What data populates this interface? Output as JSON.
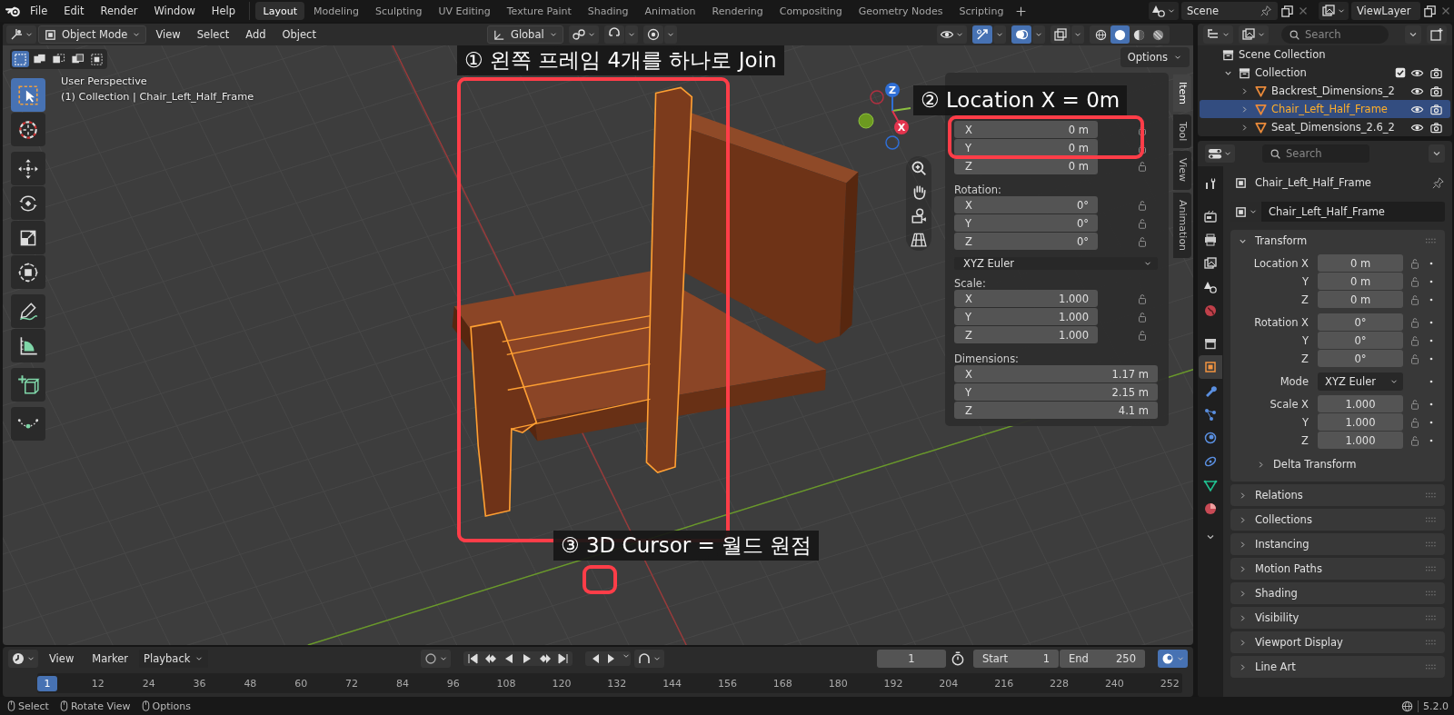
{
  "menu": [
    "File",
    "Edit",
    "Render",
    "Window",
    "Help"
  ],
  "workspace_tabs": [
    {
      "label": "Layout",
      "selected": true
    },
    {
      "label": "Modeling",
      "selected": false
    },
    {
      "label": "Sculpting",
      "selected": false
    },
    {
      "label": "UV Editing",
      "selected": false
    },
    {
      "label": "Texture Paint",
      "selected": false
    },
    {
      "label": "Shading",
      "selected": false
    },
    {
      "label": "Animation",
      "selected": false
    },
    {
      "label": "Rendering",
      "selected": false
    },
    {
      "label": "Compositing",
      "selected": false
    },
    {
      "label": "Geometry Nodes",
      "selected": false
    },
    {
      "label": "Scripting",
      "selected": false
    }
  ],
  "scene": {
    "name": "Scene"
  },
  "view_layer": {
    "name": "ViewLayer"
  },
  "viewport": {
    "header": {
      "mode": "Object Mode",
      "menus": [
        "View",
        "Select",
        "Add",
        "Object"
      ],
      "orientation": "Global",
      "toggles": [
        {
          "kind": "snap",
          "on": false
        },
        {
          "kind": "proportional",
          "on": false
        },
        {
          "kind": "gizmo",
          "on": true
        },
        {
          "kind": "overlay",
          "on": true
        },
        {
          "kind": "xray",
          "on": false
        }
      ],
      "shading_modes": [
        {
          "kind": "wireframe",
          "selected": false
        },
        {
          "kind": "solid",
          "selected": true
        },
        {
          "kind": "material",
          "selected": false
        },
        {
          "kind": "rendered",
          "selected": false
        }
      ]
    },
    "select_modes": [
      {
        "kind": "set",
        "selected": true
      },
      {
        "kind": "extend",
        "selected": false
      },
      {
        "kind": "subtract",
        "selected": false
      },
      {
        "kind": "invert",
        "selected": false
      },
      {
        "kind": "intersect",
        "selected": false
      }
    ],
    "options": "Options",
    "view_info": [
      "User Perspective",
      "(1) Collection | Chair_Left_Half_Frame"
    ],
    "tool_groups": [
      {
        "tools": [
          {
            "kind": "select_box",
            "selected": true
          },
          {
            "kind": "cursor",
            "selected": false
          }
        ]
      },
      {
        "tools": [
          {
            "kind": "move",
            "selected": false
          },
          {
            "kind": "rotate",
            "selected": false
          },
          {
            "kind": "scale",
            "selected": false
          },
          {
            "kind": "transform",
            "selected": false
          }
        ]
      },
      {
        "tools": [
          {
            "kind": "annotate",
            "selected": false
          },
          {
            "kind": "measure",
            "selected": false
          }
        ]
      },
      {
        "tools": [
          {
            "kind": "add_cube",
            "selected": false
          }
        ]
      },
      {
        "tools": [
          {
            "kind": "curve",
            "selected": false
          }
        ]
      }
    ],
    "gizmo_axes": [
      {
        "label": "Z",
        "color": "#2f6fd6"
      },
      {
        "label": "X",
        "color": "#e3344e"
      }
    ],
    "sidebar": {
      "tabs": [
        {
          "label": "Item",
          "selected": true
        },
        {
          "label": "Tool",
          "selected": false
        },
        {
          "label": "View",
          "selected": false
        },
        {
          "label": "Animation",
          "selected": false
        }
      ],
      "groups": [
        {
          "kind": "locked",
          "fields": [
            {
              "axis": "X",
              "value": "0 m"
            },
            {
              "axis": "Y",
              "value": "0 m"
            },
            {
              "axis": "Z",
              "value": "0 m"
            }
          ]
        },
        {
          "kind": "locked",
          "label": "Rotation:",
          "fields": [
            {
              "axis": "X",
              "value": "0°"
            },
            {
              "axis": "Y",
              "value": "0°"
            },
            {
              "axis": "Z",
              "value": "0°"
            }
          ]
        },
        {
          "kind": "dropdown",
          "value": "XYZ Euler"
        },
        {
          "kind": "locked",
          "label": "Scale:",
          "fields": [
            {
              "axis": "X",
              "value": "1.000"
            },
            {
              "axis": "Y",
              "value": "1.000"
            },
            {
              "axis": "Z",
              "value": "1.000"
            }
          ]
        },
        {
          "kind": "plain",
          "label": "Dimensions:",
          "fields": [
            {
              "axis": "X",
              "value": "1.17 m"
            },
            {
              "axis": "Y",
              "value": "2.15 m"
            },
            {
              "axis": "Z",
              "value": "4.1 m"
            }
          ]
        }
      ]
    },
    "annotations": [
      {
        "label": "① 왼쪽 프레임 4개를 하나로 Join"
      },
      {
        "label": "② Location X = 0m"
      },
      {
        "label": "③ 3D Cursor = 월드 원점"
      }
    ]
  },
  "timeline": {
    "menus": [
      "View",
      "Marker"
    ],
    "playback": "Playback",
    "current_frame": "1",
    "start": {
      "label": "Start",
      "value": "1"
    },
    "end": {
      "label": "End",
      "value": "250"
    },
    "ruler": [
      {
        "label": "1",
        "selected": true
      },
      {
        "label": "12",
        "selected": false
      },
      {
        "label": "24",
        "selected": false
      },
      {
        "label": "36",
        "selected": false
      },
      {
        "label": "48",
        "selected": false
      },
      {
        "label": "60",
        "selected": false
      },
      {
        "label": "72",
        "selected": false
      },
      {
        "label": "84",
        "selected": false
      },
      {
        "label": "96",
        "selected": false
      },
      {
        "label": "108",
        "selected": false
      },
      {
        "label": "120",
        "selected": false
      },
      {
        "label": "132",
        "selected": false
      },
      {
        "label": "144",
        "selected": false
      },
      {
        "label": "156",
        "selected": false
      },
      {
        "label": "168",
        "selected": false
      },
      {
        "label": "180",
        "selected": false
      },
      {
        "label": "192",
        "selected": false
      },
      {
        "label": "204",
        "selected": false
      },
      {
        "label": "216",
        "selected": false
      },
      {
        "label": "228",
        "selected": false
      },
      {
        "label": "240",
        "selected": false
      },
      {
        "label": "252",
        "selected": false
      }
    ]
  },
  "outliner": {
    "search": {
      "placeholder": "Search"
    },
    "tree": [
      {
        "label": "Scene Collection",
        "kind": "scene",
        "selected": false,
        "children": [
          {
            "label": "Collection",
            "kind": "collection",
            "selected": false,
            "expanded": true,
            "checked": true,
            "children": [
              {
                "label": "Backrest_Dimensions_2",
                "kind": "mesh",
                "selected": false,
                "expanded": false
              },
              {
                "label": "Chair_Left_Half_Frame",
                "kind": "mesh",
                "selected": true,
                "expanded": false
              },
              {
                "label": "Seat_Dimensions_2.6_2",
                "kind": "mesh",
                "selected": false,
                "expanded": false
              }
            ]
          }
        ]
      }
    ]
  },
  "properties": {
    "search": {
      "placeholder": "Search"
    },
    "tabs": [
      {
        "kind": "tool",
        "selected": false
      },
      {
        "kind": "render",
        "selected": false
      },
      {
        "kind": "output",
        "selected": false
      },
      {
        "kind": "view_layer",
        "selected": false
      },
      {
        "kind": "scene",
        "selected": false
      },
      {
        "kind": "world",
        "selected": false
      },
      {
        "kind": "collection",
        "selected": false
      },
      {
        "kind": "object",
        "selected": true
      },
      {
        "kind": "modifiers",
        "selected": false
      },
      {
        "kind": "particles",
        "selected": false
      },
      {
        "kind": "physics",
        "selected": false
      },
      {
        "kind": "constraints",
        "selected": false
      },
      {
        "kind": "data",
        "selected": false
      },
      {
        "kind": "material",
        "selected": false
      }
    ],
    "title": "Chair_Left_Half_Frame",
    "name_field": "Chair_Left_Half_Frame",
    "panels": [
      {
        "title": "Transform",
        "expanded": true,
        "groups": [
          {
            "kind": "vector",
            "rows": [
              {
                "label": "Location X",
                "value": "0 m"
              },
              {
                "label": "Y",
                "value": "0 m"
              },
              {
                "label": "Z",
                "value": "0 m"
              }
            ]
          },
          {
            "kind": "vector",
            "rows": [
              {
                "label": "Rotation X",
                "value": "0°"
              },
              {
                "label": "Y",
                "value": "0°"
              },
              {
                "label": "Z",
                "value": "0°"
              }
            ]
          },
          {
            "kind": "dropdown",
            "label": "Mode",
            "value": "XYZ Euler"
          },
          {
            "kind": "vector",
            "rows": [
              {
                "label": "Scale X",
                "value": "1.000"
              },
              {
                "label": "Y",
                "value": "1.000"
              },
              {
                "label": "Z",
                "value": "1.000"
              }
            ]
          }
        ],
        "subpanels": [
          {
            "title": "Delta Transform",
            "expanded": false
          }
        ]
      },
      {
        "title": "Relations",
        "expanded": false
      },
      {
        "title": "Collections",
        "expanded": false
      },
      {
        "title": "Instancing",
        "expanded": false
      },
      {
        "title": "Motion Paths",
        "expanded": false
      },
      {
        "title": "Shading",
        "expanded": false
      },
      {
        "title": "Visibility",
        "expanded": false
      },
      {
        "title": "Viewport Display",
        "expanded": false
      },
      {
        "title": "Line Art",
        "expanded": false
      }
    ]
  },
  "status_bar": {
    "hints": [
      "Select",
      "Rotate View",
      "Options"
    ],
    "version": "5.2.0"
  }
}
